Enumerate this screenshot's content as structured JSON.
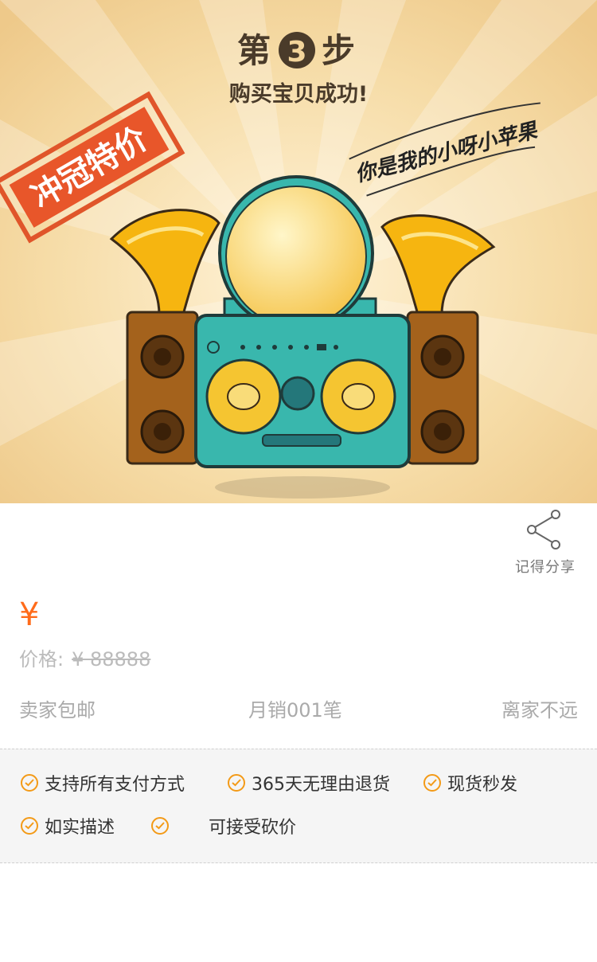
{
  "hero": {
    "step_prefix": "第",
    "step_number": "3",
    "step_suffix": "步",
    "subtitle": "购买宝贝成功!",
    "stamp_text": "冲冠特价",
    "handwriting": "你是我的小呀小苹果"
  },
  "share": {
    "label": "记得分享",
    "icon": "share-icon"
  },
  "price": {
    "symbol": "¥",
    "original_label": "价格:",
    "original_value": "¥  88888"
  },
  "meta": {
    "shipping": "卖家包邮",
    "monthly_sales": "月销001笔",
    "distance": "离家不远"
  },
  "guarantees": [
    {
      "label": "支持所有支付方式"
    },
    {
      "label": "365天无理由退货"
    },
    {
      "label": "现货秒发"
    },
    {
      "label": "如实描述"
    },
    {
      "label": ""
    },
    {
      "label": "可接受砍价"
    }
  ],
  "colors": {
    "accent": "#ff6b1a",
    "check": "#f39a17",
    "hero_bg": "#f3d49a",
    "teal": "#39b7ad"
  }
}
